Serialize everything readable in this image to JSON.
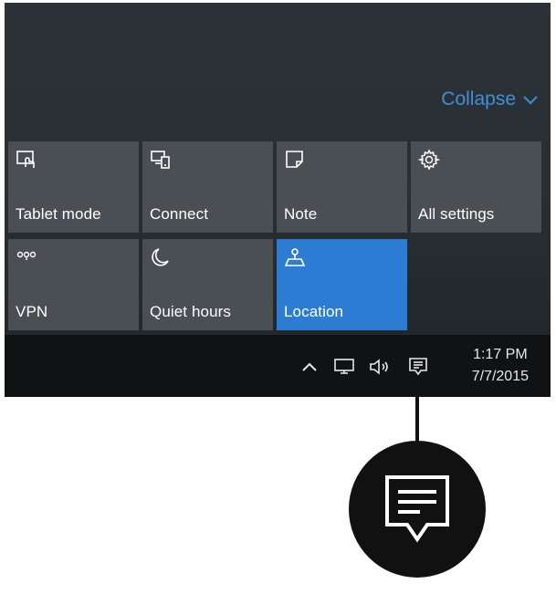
{
  "panel": {
    "collapse_label": "Collapse",
    "accent_color": "#2d7cd4",
    "tiles": [
      {
        "label": "Tablet mode",
        "icon": "tablet-mode-icon"
      },
      {
        "label": "Connect",
        "icon": "connect-icon"
      },
      {
        "label": "Note",
        "icon": "note-icon"
      },
      {
        "label": "All settings",
        "icon": "gear-icon"
      },
      {
        "label": "VPN",
        "icon": "vpn-icon"
      },
      {
        "label": "Quiet hours",
        "icon": "moon-icon"
      },
      {
        "label": "Location",
        "icon": "location-icon",
        "active": true
      }
    ]
  },
  "taskbar": {
    "icons": [
      "chevron-up-icon",
      "network-icon",
      "volume-icon",
      "action-center-icon"
    ],
    "clock": {
      "time": "1:17 PM",
      "date": "7/7/2015"
    }
  },
  "callout": {
    "icon": "action-center-icon"
  }
}
